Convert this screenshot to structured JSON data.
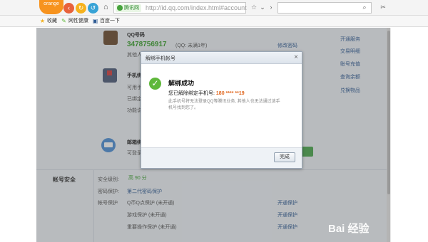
{
  "browser": {
    "logo_text": "orange",
    "secure_badge": "腾讯网",
    "url": "http://id.qq.com/index.html#account",
    "search_value": "",
    "bookmarks": [
      "收藏",
      "网性健康",
      "百度一下"
    ]
  },
  "page": {
    "qq": {
      "title": "QQ号码",
      "number": "3478756917",
      "sub": "(QQ: 未满1年)",
      "other": "其他人",
      "edit_link": "修改密码"
    },
    "phone": {
      "title": "手机绑",
      "line1": "可用手",
      "line2": "已绑定",
      "line3": "功能说"
    },
    "mail": {
      "title": "邮箱绑",
      "line1": "可登录"
    },
    "side_links": [
      "开通服务",
      "交易明细",
      "账号充值",
      "查询余额",
      "兑换物品"
    ],
    "account_security": {
      "title": "帐号安全",
      "rows": [
        {
          "label": "安全级别:",
          "value": "高  90  分",
          "action": ""
        },
        {
          "label": "密码保护:",
          "value": "第二代密码保护",
          "action": ""
        },
        {
          "label": "帐号保护",
          "value": "Q币Q点保护  (未开通)",
          "action": "开通保护"
        },
        {
          "label": "",
          "value": "游戏保护  (未开通)",
          "action": "开通保护"
        },
        {
          "label": "",
          "value": "重要操作保护  (未开通)",
          "action": "开通保护"
        }
      ]
    }
  },
  "dialog": {
    "title": "解绑手机帐号",
    "success_title": "解绑成功",
    "message_prefix": "您已解除绑定手机号:",
    "phone_masked": "180 **** **19",
    "note": "此手机号将无法登录QQ等腾讯业务, 其他人也无法通过该手机号找到您了。",
    "done_button": "完成",
    "close": "×"
  },
  "watermark": "Bai  经验"
}
